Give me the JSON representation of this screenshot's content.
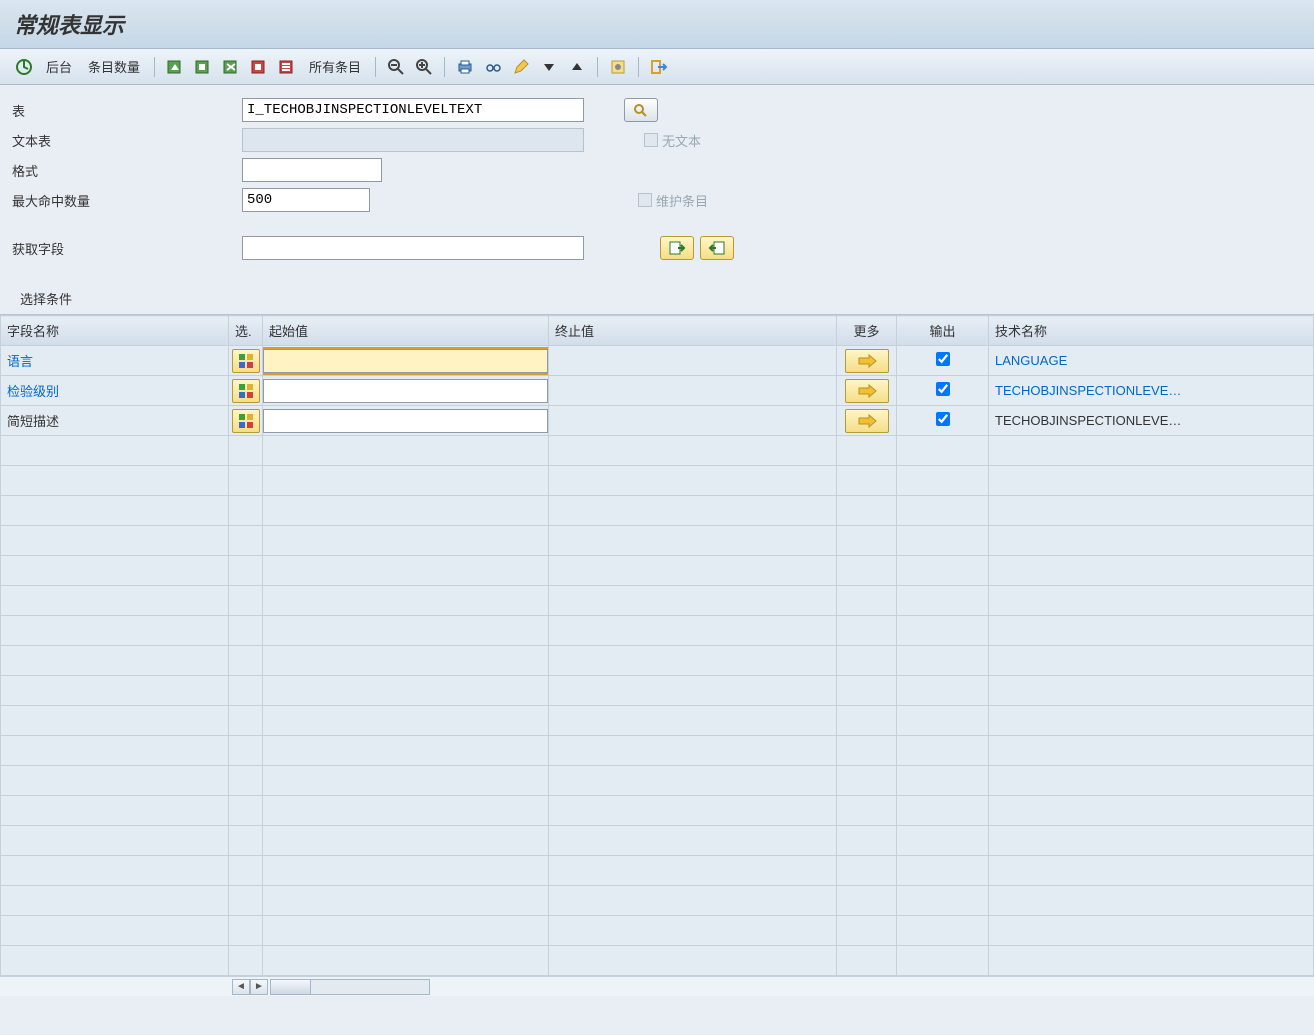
{
  "title": "常规表显示",
  "toolbar": {
    "background_label": "后台",
    "entry_count_label": "条目数量",
    "all_entries_label": "所有条目"
  },
  "form": {
    "table_label": "表",
    "table_value": "I_TECHOBJINSPECTIONLEVELTEXT",
    "text_table_label": "文本表",
    "text_table_value": "",
    "no_text_label": "无文本",
    "format_label": "格式",
    "format_value": "",
    "max_hits_label": "最大命中数量",
    "max_hits_value": "500",
    "maintain_entries_label": "维护条目",
    "get_fields_label": "获取字段",
    "get_fields_value": ""
  },
  "selection": {
    "header": "选择条件",
    "cols": {
      "field": "字段名称",
      "sel": "选.",
      "from": "起始值",
      "to": "终止值",
      "more": "更多",
      "output": "输出",
      "tech": "技术名称"
    },
    "rows": [
      {
        "field": "语言",
        "link": true,
        "from": "",
        "to": "",
        "output": true,
        "tech": "LANGUAGE",
        "tech_link": true,
        "focused": true
      },
      {
        "field": "检验级别",
        "link": true,
        "from": "",
        "to": "",
        "output": true,
        "tech": "TECHOBJINSPECTIONLEVE…",
        "tech_link": true,
        "focused": false
      },
      {
        "field": "简短描述",
        "link": false,
        "from": "",
        "to": "",
        "output": true,
        "tech": "TECHOBJINSPECTIONLEVE…",
        "tech_link": false,
        "focused": false
      }
    ],
    "empty_rows": 18
  }
}
